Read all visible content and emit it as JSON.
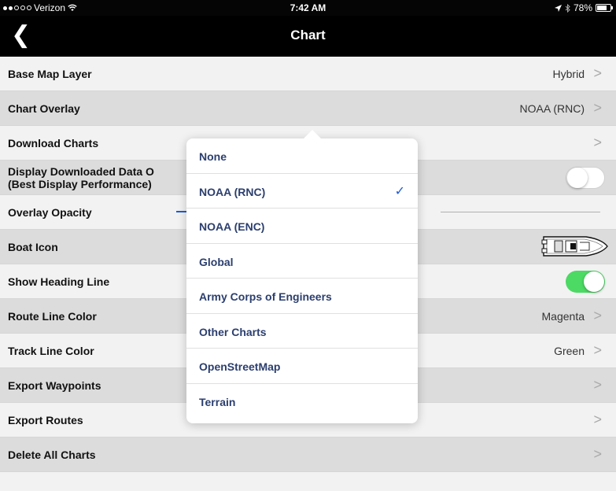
{
  "status_bar": {
    "carrier": "Verizon",
    "time": "7:42 AM",
    "battery": "78%",
    "battery_level": 0.78
  },
  "nav": {
    "title": "Chart",
    "back_glyph": "❮"
  },
  "rows": [
    {
      "label": "Base Map Layer",
      "value": "Hybrid"
    },
    {
      "label": "Chart Overlay",
      "value": "NOAA (RNC)"
    },
    {
      "label": "Download Charts"
    },
    {
      "label_line1": "Display Downloaded Data O",
      "label_line2": "(Best Display Performance)",
      "toggle": "off"
    },
    {
      "label": "Overlay Opacity"
    },
    {
      "label": "Boat Icon"
    },
    {
      "label": "Show Heading Line",
      "toggle": "on"
    },
    {
      "label": "Route Line Color",
      "value": "Magenta"
    },
    {
      "label": "Track Line Color",
      "value": "Green"
    },
    {
      "label": "Export Waypoints"
    },
    {
      "label": "Export Routes"
    },
    {
      "label": "Delete All Charts"
    }
  ],
  "chevron": ">",
  "popover": {
    "options": [
      {
        "label": "None"
      },
      {
        "label": "NOAA (RNC)",
        "selected": true
      },
      {
        "label": "NOAA (ENC)"
      },
      {
        "label": "Global"
      },
      {
        "label": "Army Corps of Engineers"
      },
      {
        "label": "Other Charts"
      },
      {
        "label": "OpenStreetMap"
      },
      {
        "label": "Terrain"
      }
    ],
    "check_glyph": "✓"
  },
  "icons": {
    "wifi": "wifi-icon",
    "location": "location-arrow-icon",
    "bluetooth": "bluetooth-icon",
    "battery": "battery-icon",
    "back": "chevron-left-icon",
    "chevron": "chevron-right-icon",
    "boat": "boat-icon",
    "check": "checkmark-icon"
  },
  "colors": {
    "accent": "#1e5bd8",
    "option_text": "#2b3e6e",
    "toggle_on": "#4cd964"
  }
}
